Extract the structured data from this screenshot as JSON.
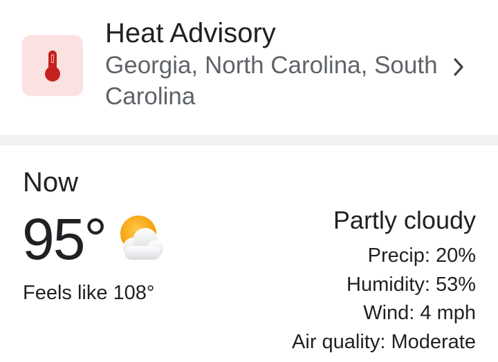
{
  "alert": {
    "title": "Heat Advisory",
    "regions": "Georgia, North Carolina, South Carolina",
    "icon": "thermometer-icon",
    "accent_color": "#c5221f",
    "tile_color": "#fce1e1"
  },
  "current": {
    "heading": "Now",
    "temperature": "95°",
    "feels_like": "Feels like 108°",
    "condition": "Partly cloudy",
    "icon": "partly-cloudy-icon",
    "details": {
      "precip": "Precip: 20%",
      "humidity": "Humidity: 53%",
      "wind": "Wind: 4 mph",
      "air_quality": "Air quality: Moderate"
    }
  }
}
